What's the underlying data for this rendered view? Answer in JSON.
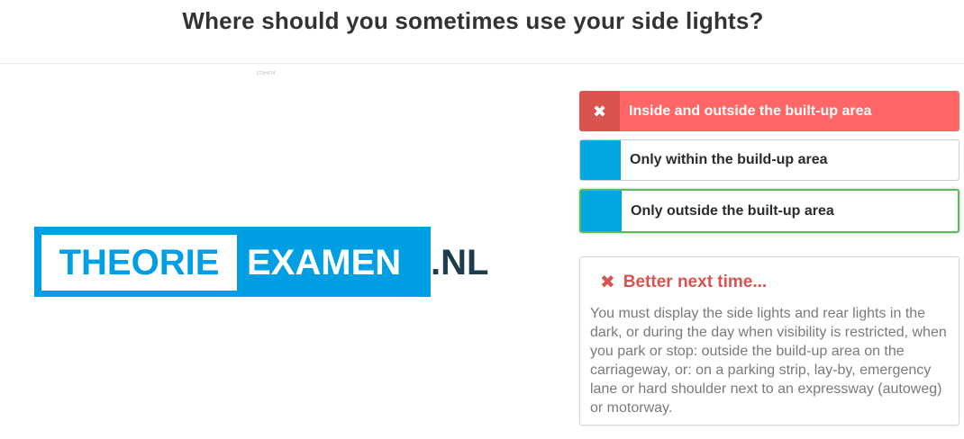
{
  "question": "Where should you sometimes use your side lights?",
  "image_id": "2T9H4T4",
  "logo": {
    "part1": "THEORIE",
    "part2": "EXAMEN",
    "part3": ".NL"
  },
  "answers": [
    {
      "label": "Inside and outside the built-up area",
      "state": "wrong",
      "marker_icon": "close-icon"
    },
    {
      "label": "Only within the build-up area",
      "state": "neutral"
    },
    {
      "label": "Only outside the built-up area",
      "state": "correct"
    }
  ],
  "feedback": {
    "icon": "close-icon",
    "title": "Better next time...",
    "text": "You must display the side lights and rear lights in the dark, or during the day when visibility is restricted, when you park or stop: outside the build-up area on the carriageway, or: on a parking strip, lay-by, emergency lane or hard shoulder next to an expressway (autoweg) or motorway."
  },
  "colors": {
    "wrong_bg": "#ff6666",
    "wrong_marker": "#d9534f",
    "answer_marker": "#00a7e1",
    "correct_border": "#5cb85c",
    "logo_blue": "#009fe3",
    "logo_dark": "#1d3c4c",
    "feedback_title": "#d9534f"
  }
}
